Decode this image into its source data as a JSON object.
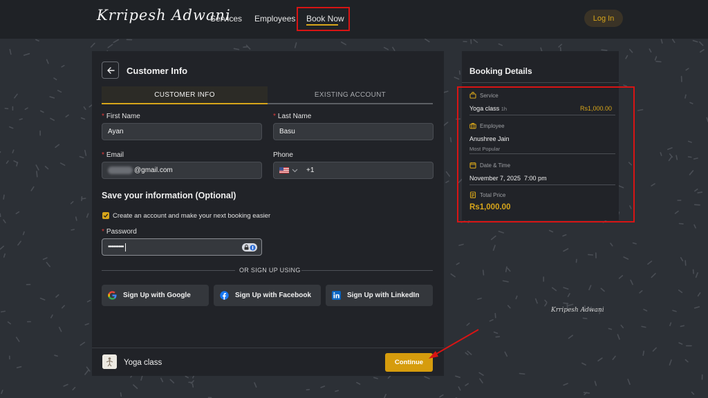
{
  "brand": "Krripesh Adwani",
  "nav": {
    "services": "Services",
    "employees": "Employees",
    "book_now": "Book Now",
    "login": "Log In"
  },
  "form": {
    "title": "Customer Info",
    "tabs": [
      "CUSTOMER INFO",
      "EXISTING ACCOUNT"
    ],
    "first_name_label": "First Name",
    "first_name_value": "Ayan",
    "last_name_label": "Last Name",
    "last_name_value": "Basu",
    "email_label": "Email",
    "email_value": "@gmail.com",
    "phone_label": "Phone",
    "phone_code": "+1",
    "save_title": "Save your information (Optional)",
    "create_account_label": "Create an account and make your next booking easier",
    "create_account_checked": true,
    "password_label": "Password",
    "password_value": "•••••••••",
    "or_text": "OR SIGN UP USING",
    "social": {
      "google": "Sign Up with Google",
      "facebook": "Sign Up with Facebook",
      "linkedin": "Sign Up with LinkedIn"
    }
  },
  "footer": {
    "service": "Yoga class",
    "continue": "Continue"
  },
  "booking": {
    "title": "Booking Details",
    "service_label": "Service",
    "service_name": "Yoga class",
    "service_duration": "1h",
    "service_price": "Rs1,000.00",
    "employee_label": "Employee",
    "employee_name": "Anushree Jain",
    "employee_tag": "Most Popular",
    "datetime_label": "Date & Time",
    "datetime_value": "November 7, 2025  7:00 pm",
    "total_label": "Total Price",
    "total_value": "Rs1,000.00"
  },
  "watermark": "Krripesh Adwani",
  "colors": {
    "accent": "#d7a51a",
    "highlight_box": "#d81414",
    "background": "#2c3036",
    "panel": "#212328"
  }
}
